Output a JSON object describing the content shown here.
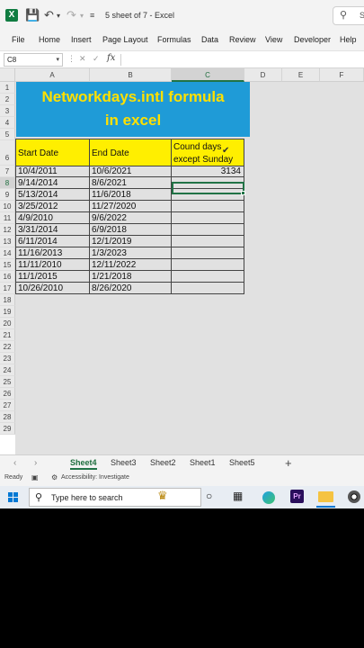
{
  "titlebar": {
    "app_letter": "X",
    "doc_title": "5 sheet of 7  -  Excel",
    "search_hint": "S"
  },
  "ribbon": {
    "tabs": [
      "File",
      "Home",
      "Insert",
      "Page Layout",
      "Formulas",
      "Data",
      "Review",
      "View",
      "Developer",
      "Help"
    ]
  },
  "formula_bar": {
    "name_box": "C8",
    "cancel_glyph": "✕",
    "enter_glyph": "✓",
    "fx_label": "fx",
    "formula": ""
  },
  "grid": {
    "columns": [
      "A",
      "B",
      "C",
      "D",
      "E",
      "F"
    ],
    "selected_column": "C",
    "rows": [
      "1",
      "2",
      "3",
      "4",
      "5",
      "6",
      "7",
      "8",
      "9",
      "10",
      "11",
      "12",
      "13",
      "14",
      "15",
      "16",
      "17",
      "18",
      "19",
      "20",
      "21",
      "22",
      "23",
      "24",
      "25",
      "26",
      "27",
      "28",
      "29"
    ],
    "selected_row": "8"
  },
  "banner": {
    "line1": "Networkdays.intl formula",
    "line2": "in excel",
    "fill": "#1f9bd7",
    "text_color": "#ffe000"
  },
  "table": {
    "headers": [
      "Start Date",
      "End Date",
      "Cound days",
      "except Sunday"
    ],
    "header_fill": "#ffef00",
    "rows": [
      [
        "10/4/2011",
        "10/6/2021",
        "3134"
      ],
      [
        "9/14/2014",
        "8/6/2021",
        ""
      ],
      [
        "5/13/2014",
        "11/6/2018",
        ""
      ],
      [
        "3/25/2012",
        "11/27/2020",
        ""
      ],
      [
        "4/9/2010",
        "9/6/2022",
        ""
      ],
      [
        "3/31/2014",
        "6/9/2018",
        ""
      ],
      [
        "6/11/2014",
        "12/1/2019",
        ""
      ],
      [
        "11/16/2013",
        "1/3/2023",
        ""
      ],
      [
        "11/11/2010",
        "12/11/2022",
        ""
      ],
      [
        "11/1/2015",
        "1/21/2018",
        ""
      ],
      [
        "10/26/2010",
        "8/26/2020",
        ""
      ]
    ]
  },
  "sheet_tabs": {
    "tabs": [
      "Sheet4",
      "Sheet3",
      "Sheet2",
      "Sheet1",
      "Sheet5"
    ],
    "active": "Sheet4",
    "prev_glyph": "‹",
    "next_glyph": "›",
    "add_glyph": "+"
  },
  "status_bar": {
    "ready": "Ready",
    "accessibility": "Accessibility: Investigate"
  },
  "taskbar": {
    "search_placeholder": "Type here to search",
    "premiere_label": "Pr"
  },
  "colors": {
    "excel_green": "#217346",
    "windows_blue": "#0078d4"
  }
}
